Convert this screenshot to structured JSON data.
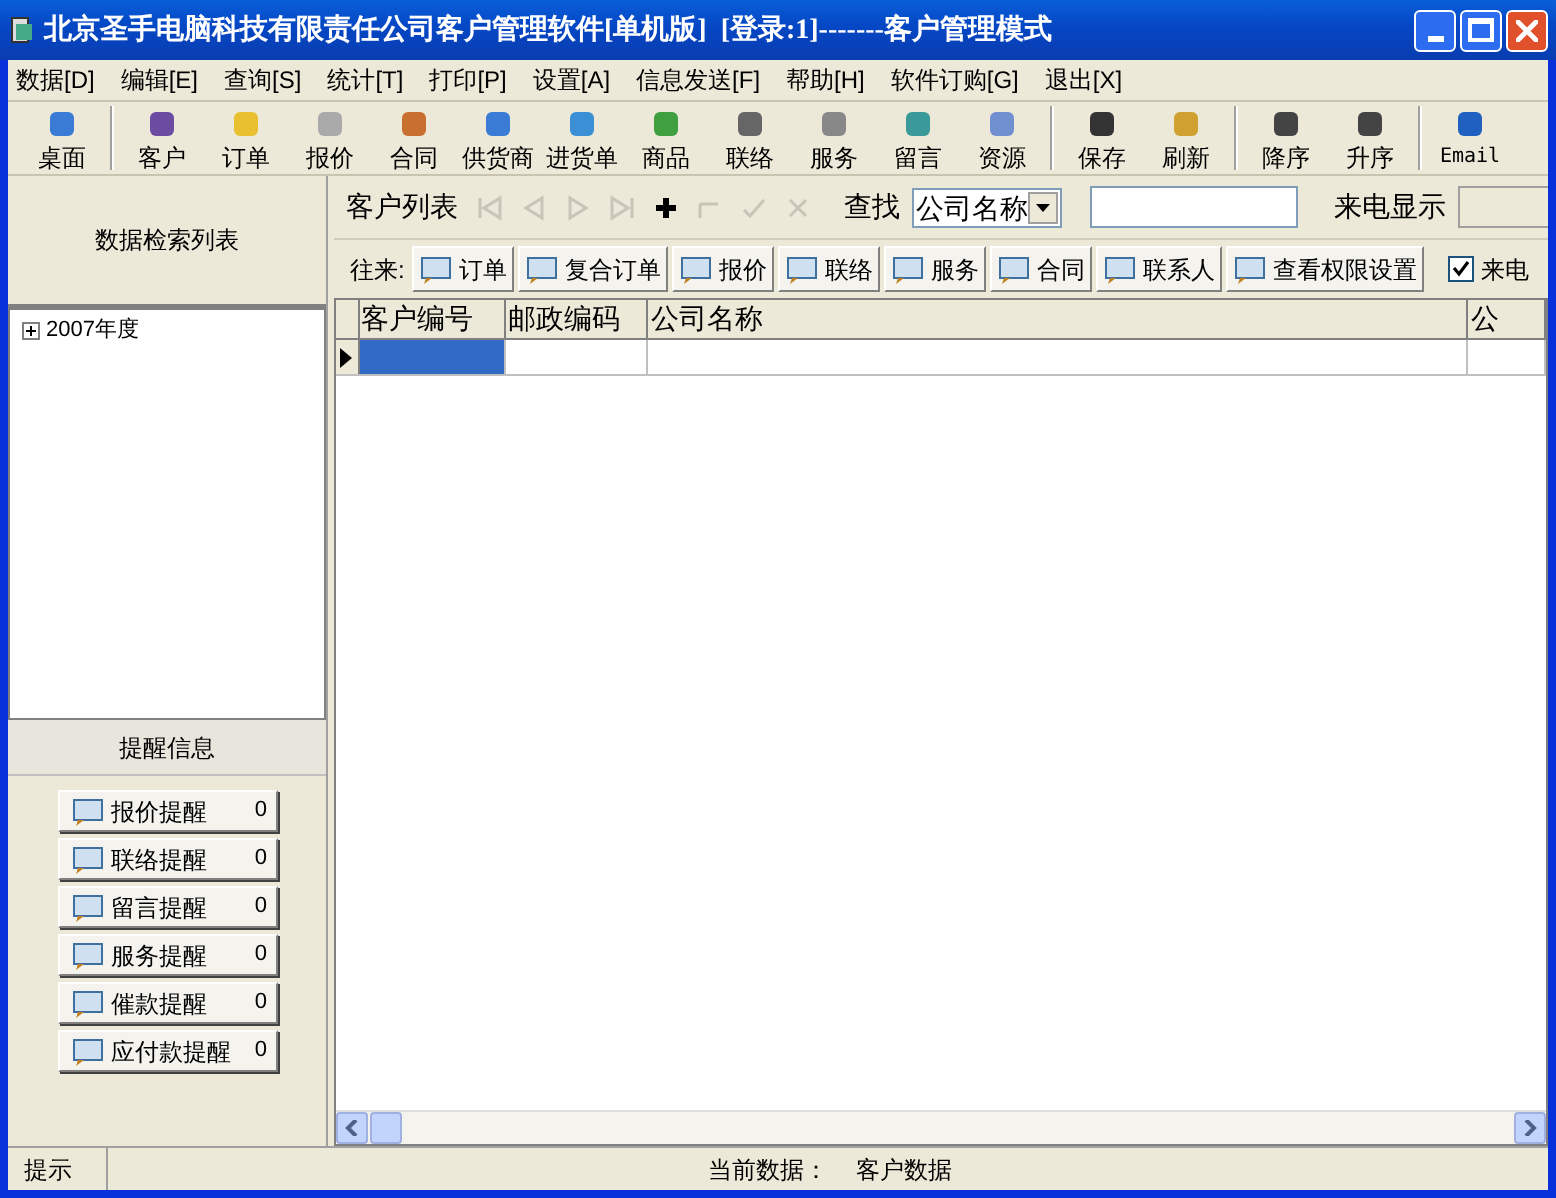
{
  "window": {
    "title": "北京圣手电脑科技有限责任公司客户管理软件[单机版]  [登录:1]-------客户管理模式"
  },
  "menu": [
    "数据[D]",
    "编辑[E]",
    "查询[S]",
    "统计[T]",
    "打印[P]",
    "设置[A]",
    "信息发送[F]",
    "帮助[H]",
    "软件订购[G]",
    "退出[X]"
  ],
  "toolbar": [
    {
      "label": "桌面",
      "separator_before": false
    },
    {
      "label": "客户",
      "separator_before": true
    },
    {
      "label": "订单",
      "separator_before": false
    },
    {
      "label": "报价",
      "separator_before": false
    },
    {
      "label": "合同",
      "separator_before": false
    },
    {
      "label": "供货商",
      "separator_before": false
    },
    {
      "label": "进货单",
      "separator_before": false
    },
    {
      "label": "商品",
      "separator_before": false
    },
    {
      "label": "联络",
      "separator_before": false
    },
    {
      "label": "服务",
      "separator_before": false
    },
    {
      "label": "留言",
      "separator_before": false
    },
    {
      "label": "资源",
      "separator_before": false
    },
    {
      "label": "保存",
      "separator_before": true
    },
    {
      "label": "刷新",
      "separator_before": false
    },
    {
      "label": "降序",
      "separator_before": true
    },
    {
      "label": "升序",
      "separator_before": false
    },
    {
      "label": "Email",
      "separator_before": true
    }
  ],
  "sidebar": {
    "header": "数据检索列表",
    "tree": [
      {
        "label": "2007年度",
        "expanded": false
      }
    ],
    "reminder_header": "提醒信息",
    "reminders": [
      {
        "label": "报价提醒",
        "count": "0"
      },
      {
        "label": "联络提醒",
        "count": "0"
      },
      {
        "label": "留言提醒",
        "count": "0"
      },
      {
        "label": "服务提醒",
        "count": "0"
      },
      {
        "label": "催款提醒",
        "count": "0"
      },
      {
        "label": "应付款提醒",
        "count": "0"
      }
    ]
  },
  "list_bar": {
    "title": "客户列表",
    "nav_buttons": [
      {
        "kind": "first",
        "disabled": true
      },
      {
        "kind": "prev",
        "disabled": true
      },
      {
        "kind": "next",
        "disabled": true
      },
      {
        "kind": "last",
        "disabled": true
      },
      {
        "kind": "add",
        "disabled": false
      },
      {
        "kind": "edit",
        "disabled": true
      },
      {
        "kind": "post",
        "disabled": true
      },
      {
        "kind": "cancel",
        "disabled": true
      }
    ],
    "find_label": "查找",
    "find_field": "公司名称",
    "caller_label": "来电显示"
  },
  "links_bar": {
    "label": "往来:",
    "buttons": [
      "订单",
      "复合订单",
      "报价",
      "联络",
      "服务",
      "合同",
      "联系人",
      "查看权限设置"
    ],
    "checkbox": {
      "label": "来电",
      "checked": true
    }
  },
  "table": {
    "columns": [
      "客户编号",
      "邮政编码",
      "公司名称",
      "公"
    ],
    "rows": [
      {
        "current": true,
        "cells": [
          {
            "selected": true
          },
          {
            "selected": false
          },
          {
            "selected": false
          },
          {
            "selected": false
          }
        ]
      }
    ]
  },
  "status_bar": {
    "hint": "提示",
    "current_label": "当前数据：",
    "current_value": "客户数据"
  }
}
